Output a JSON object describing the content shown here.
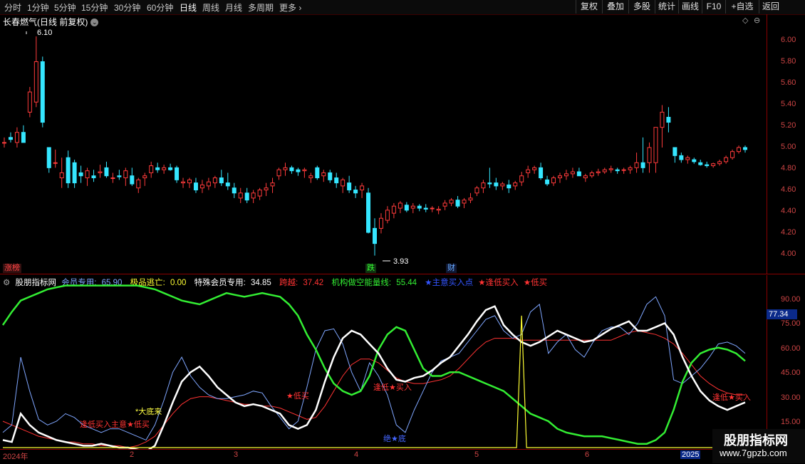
{
  "toolbar": {
    "periods": [
      "分时",
      "1分钟",
      "5分钟",
      "15分钟",
      "30分钟",
      "60分钟",
      "日线",
      "周线",
      "月线",
      "多周期",
      "更多"
    ],
    "active_period": "日线",
    "right_buttons": [
      "复权",
      "叠加",
      "多股",
      "统计",
      "画线",
      "F10",
      "+自选",
      "返回"
    ]
  },
  "stock": {
    "title": "长春燃气(日线 前复权)"
  },
  "price_panel": {
    "ticks": [
      "6.00",
      "5.80",
      "5.60",
      "5.40",
      "5.20",
      "5.00",
      "4.80",
      "4.60",
      "4.40",
      "4.20",
      "4.00"
    ],
    "high_label": "6.10",
    "low_label": "3.93",
    "markers": [
      {
        "text": "涨榜",
        "color": "#ff4444"
      },
      {
        "text": "跌",
        "color": "#33ff33"
      },
      {
        "text": "财",
        "color": "#66aaff"
      }
    ]
  },
  "indicator": {
    "name": "股朋指标网",
    "items": [
      {
        "label": "会员专用:",
        "value": "65.90",
        "color": "#7fa6ff"
      },
      {
        "label": "极品逃亡:",
        "value": "0.00",
        "color": "#ffff33"
      },
      {
        "label": "特殊会员专用:",
        "value": "34.85",
        "color": "#ffffff"
      },
      {
        "label": "跨越:",
        "value": "37.42",
        "color": "#ff3333"
      },
      {
        "label": "机构做空能量线:",
        "value": "55.44",
        "color": "#33ee33"
      }
    ],
    "signals": [
      {
        "text": "★主意买入点",
        "color": "#3355ff"
      },
      {
        "text": "★逢低买入",
        "color": "#ff3333"
      },
      {
        "text": "★低买",
        "color": "#ff3333"
      }
    ],
    "ticks": [
      "90.00",
      "75.00",
      "60.00",
      "45.00",
      "30.00",
      "15.00"
    ],
    "current_value": "77.34",
    "chart_labels": [
      {
        "text": "*大底来",
        "color": "#ffff44"
      },
      {
        "text": "逢低买入主意★低买",
        "color": "#ff3333"
      },
      {
        "text": "★低买",
        "color": "#ff3333"
      },
      {
        "text": "逢低★买入",
        "color": "#ff3333"
      },
      {
        "text": "绝★底",
        "color": "#4466ff"
      },
      {
        "text": "逢低★买入",
        "color": "#ff3333"
      }
    ]
  },
  "dates": [
    "2024年",
    "2",
    "3",
    "4",
    "5",
    "6",
    "2025"
  ],
  "watermark": {
    "title": "股朋指标网",
    "url": "www.7gpzb.com"
  },
  "chart_data": {
    "type": "candlestick",
    "ylim": [
      3.85,
      6.15
    ],
    "candles": [
      [
        5.05,
        5.1,
        5.0,
        5.05
      ],
      [
        5.1,
        5.15,
        5.05,
        5.08
      ],
      [
        5.05,
        5.2,
        5.0,
        5.15
      ],
      [
        5.15,
        5.22,
        5.05,
        5.05
      ],
      [
        5.35,
        5.6,
        5.3,
        5.55
      ],
      [
        5.45,
        6.1,
        5.4,
        5.85
      ],
      [
        5.85,
        5.9,
        5.2,
        5.25
      ],
      [
        5.0,
        5.0,
        4.75,
        4.8
      ],
      [
        4.85,
        4.98,
        4.8,
        4.85
      ],
      [
        4.7,
        4.9,
        4.6,
        4.75
      ],
      [
        4.9,
        4.97,
        4.6,
        4.65
      ],
      [
        4.85,
        4.88,
        4.6,
        4.65
      ],
      [
        4.75,
        4.82,
        4.65,
        4.72
      ],
      [
        4.7,
        4.8,
        4.62,
        4.77
      ],
      [
        4.72,
        4.78,
        4.66,
        4.7
      ],
      [
        4.75,
        4.83,
        4.7,
        4.76
      ],
      [
        4.8,
        4.86,
        4.7,
        4.72
      ],
      [
        4.7,
        4.75,
        4.65,
        4.7
      ],
      [
        4.72,
        4.78,
        4.68,
        4.71
      ],
      [
        4.7,
        4.8,
        4.62,
        4.77
      ],
      [
        4.72,
        4.8,
        4.62,
        4.64
      ],
      [
        4.6,
        4.7,
        4.55,
        4.68
      ],
      [
        4.7,
        4.75,
        4.62,
        4.72
      ],
      [
        4.75,
        4.86,
        4.7,
        4.82
      ],
      [
        4.8,
        4.85,
        4.75,
        4.78
      ],
      [
        4.78,
        4.83,
        4.74,
        4.8
      ],
      [
        4.8,
        4.84,
        4.77,
        4.78
      ],
      [
        4.8,
        4.82,
        4.65,
        4.68
      ],
      [
        4.65,
        4.7,
        4.6,
        4.66
      ],
      [
        4.65,
        4.7,
        4.6,
        4.68
      ],
      [
        4.65,
        4.7,
        4.55,
        4.58
      ],
      [
        4.6,
        4.68,
        4.55,
        4.63
      ],
      [
        4.62,
        4.7,
        4.58,
        4.66
      ],
      [
        4.65,
        4.72,
        4.6,
        4.7
      ],
      [
        4.7,
        4.78,
        4.62,
        4.65
      ],
      [
        4.65,
        4.75,
        4.58,
        4.62
      ],
      [
        4.6,
        4.65,
        4.5,
        4.55
      ],
      [
        4.5,
        4.6,
        4.45,
        4.55
      ],
      [
        4.55,
        4.6,
        4.45,
        4.48
      ],
      [
        4.5,
        4.58,
        4.45,
        4.55
      ],
      [
        4.52,
        4.6,
        4.48,
        4.58
      ],
      [
        4.58,
        4.65,
        4.52,
        4.6
      ],
      [
        4.62,
        4.7,
        4.55,
        4.65
      ],
      [
        4.72,
        4.8,
        4.68,
        4.78
      ],
      [
        4.78,
        4.85,
        4.72,
        4.8
      ],
      [
        4.8,
        4.82,
        4.74,
        4.77
      ],
      [
        4.78,
        4.8,
        4.72,
        4.76
      ],
      [
        4.77,
        4.8,
        4.7,
        4.78
      ],
      [
        4.7,
        4.75,
        4.65,
        4.72
      ],
      [
        4.8,
        4.82,
        4.68,
        4.7
      ],
      [
        4.72,
        4.78,
        4.66,
        4.75
      ],
      [
        4.75,
        4.78,
        4.65,
        4.68
      ],
      [
        4.7,
        4.75,
        4.6,
        4.65
      ],
      [
        4.62,
        4.7,
        4.55,
        4.68
      ],
      [
        4.65,
        4.72,
        4.55,
        4.58
      ],
      [
        4.58,
        4.62,
        4.5,
        4.55
      ],
      [
        4.58,
        4.65,
        4.5,
        4.62
      ],
      [
        4.55,
        4.6,
        4.15,
        4.16
      ],
      [
        4.2,
        4.3,
        3.93,
        4.05
      ],
      [
        4.2,
        4.35,
        4.15,
        4.3
      ],
      [
        4.28,
        4.42,
        4.25,
        4.38
      ],
      [
        4.35,
        4.45,
        4.3,
        4.42
      ],
      [
        4.4,
        4.47,
        4.35,
        4.45
      ],
      [
        4.43,
        4.46,
        4.36,
        4.38
      ],
      [
        4.4,
        4.45,
        4.35,
        4.42
      ],
      [
        4.42,
        4.44,
        4.37,
        4.4
      ],
      [
        4.4,
        4.44,
        4.36,
        4.39
      ],
      [
        4.4,
        4.42,
        4.36,
        4.4
      ],
      [
        4.38,
        4.42,
        4.34,
        4.39
      ],
      [
        4.42,
        4.48,
        4.38,
        4.45
      ],
      [
        4.45,
        4.5,
        4.42,
        4.48
      ],
      [
        4.48,
        4.52,
        4.4,
        4.42
      ],
      [
        4.45,
        4.5,
        4.4,
        4.48
      ],
      [
        4.48,
        4.55,
        4.45,
        4.5
      ],
      [
        4.55,
        4.62,
        4.52,
        4.6
      ],
      [
        4.6,
        4.68,
        4.55,
        4.65
      ],
      [
        4.65,
        4.8,
        4.6,
        4.64
      ],
      [
        4.65,
        4.7,
        4.58,
        4.62
      ],
      [
        4.62,
        4.66,
        4.58,
        4.64
      ],
      [
        4.63,
        4.68,
        4.55,
        4.6
      ],
      [
        4.62,
        4.67,
        4.58,
        4.65
      ],
      [
        4.66,
        4.76,
        4.62,
        4.72
      ],
      [
        4.75,
        4.82,
        4.7,
        4.78
      ],
      [
        4.78,
        4.82,
        4.74,
        4.8
      ],
      [
        4.8,
        4.85,
        4.68,
        4.7
      ],
      [
        4.68,
        4.72,
        4.62,
        4.64
      ],
      [
        4.65,
        4.72,
        4.62,
        4.7
      ],
      [
        4.7,
        4.75,
        4.65,
        4.72
      ],
      [
        4.72,
        4.78,
        4.68,
        4.74
      ],
      [
        4.74,
        4.8,
        4.7,
        4.76
      ],
      [
        4.76,
        4.8,
        4.72,
        4.72
      ],
      [
        4.7,
        4.74,
        4.66,
        4.72
      ],
      [
        4.72,
        4.77,
        4.7,
        4.75
      ],
      [
        4.75,
        4.79,
        4.72,
        4.76
      ],
      [
        4.76,
        4.8,
        4.74,
        4.78
      ],
      [
        4.78,
        4.82,
        4.75,
        4.79
      ],
      [
        4.78,
        4.8,
        4.74,
        4.77
      ],
      [
        4.78,
        4.8,
        4.74,
        4.78
      ],
      [
        4.78,
        4.82,
        4.74,
        4.8
      ],
      [
        4.8,
        4.95,
        4.75,
        4.85
      ],
      [
        4.85,
        5.1,
        4.75,
        4.8
      ],
      [
        4.85,
        5.05,
        4.75,
        5.0
      ],
      [
        4.85,
        5.15,
        4.75,
        5.2
      ],
      [
        5.2,
        5.42,
        5.0,
        5.35
      ],
      [
        5.3,
        5.4,
        5.15,
        5.25
      ],
      [
        5.0,
        5.0,
        4.85,
        4.92
      ],
      [
        4.92,
        4.95,
        4.85,
        4.88
      ],
      [
        4.88,
        4.92,
        4.84,
        4.9
      ],
      [
        4.88,
        4.9,
        4.84,
        4.86
      ],
      [
        4.85,
        4.88,
        4.82,
        4.83
      ],
      [
        4.83,
        4.86,
        4.8,
        4.82
      ],
      [
        4.82,
        4.85,
        4.8,
        4.84
      ],
      [
        4.84,
        4.88,
        4.82,
        4.86
      ],
      [
        4.86,
        4.92,
        4.84,
        4.9
      ],
      [
        4.9,
        4.98,
        4.88,
        4.96
      ],
      [
        4.96,
        5.02,
        4.94,
        5.0
      ],
      [
        5.0,
        5.02,
        4.95,
        4.98
      ]
    ]
  },
  "indicator_series": {
    "ylim": [
      10,
      100
    ],
    "white": [
      14,
      13,
      28,
      22,
      18,
      16,
      14,
      13,
      12,
      11,
      11,
      12,
      11,
      10,
      10,
      9,
      8,
      11,
      22,
      34,
      45,
      50,
      53,
      48,
      42,
      38,
      34,
      32,
      33,
      32,
      30,
      28,
      22,
      20,
      22,
      30,
      45,
      58,
      68,
      72,
      70,
      65,
      60,
      52,
      46,
      45,
      47,
      48,
      51,
      55,
      58,
      64,
      70,
      77,
      83,
      85,
      75,
      70,
      66,
      64,
      66,
      69,
      72,
      70,
      68,
      66,
      67,
      70,
      73,
      75,
      77,
      72,
      72,
      74,
      76,
      70,
      58,
      48,
      40,
      35,
      32,
      30,
      32,
      34
    ],
    "blue": [
      18,
      22,
      58,
      40,
      25,
      22,
      24,
      28,
      26,
      22,
      20,
      18,
      20,
      20,
      18,
      16,
      14,
      22,
      35,
      50,
      58,
      48,
      42,
      38,
      36,
      36,
      37,
      38,
      40,
      39,
      32,
      26,
      20,
      24,
      42,
      62,
      72,
      73,
      65,
      50,
      40,
      55,
      48,
      38,
      22,
      18,
      30,
      40,
      50,
      56,
      58,
      60,
      66,
      72,
      78,
      80,
      72,
      68,
      70,
      82,
      86,
      60,
      66,
      70,
      62,
      58,
      66,
      72,
      74,
      74,
      70,
      76,
      86,
      90,
      80,
      46,
      44,
      48,
      52,
      58,
      65,
      66,
      64,
      60
    ],
    "red": [
      24,
      22,
      20,
      18,
      16,
      15,
      14,
      13,
      13,
      12,
      12,
      11,
      11,
      11,
      10,
      11,
      13,
      16,
      22,
      28,
      33,
      36,
      37,
      37,
      36,
      35,
      34,
      33,
      33,
      32,
      32,
      31,
      29,
      27,
      25,
      26,
      32,
      40,
      48,
      54,
      57,
      57,
      55,
      51,
      47,
      45,
      44,
      44,
      45,
      46,
      48,
      52,
      57,
      62,
      66,
      68,
      68,
      68,
      67,
      67,
      67,
      67,
      67,
      67,
      67,
      67,
      67,
      67,
      67,
      69,
      71,
      72,
      71,
      70,
      68,
      65,
      60,
      54,
      48,
      44,
      41,
      39,
      38,
      38
    ],
    "green": [
      75,
      82,
      88,
      90,
      92,
      94,
      95,
      96,
      96,
      96,
      96,
      96,
      96,
      96,
      96,
      96,
      95,
      94,
      92,
      90,
      88,
      87,
      86,
      88,
      90,
      92,
      91,
      90,
      91,
      92,
      91,
      90,
      86,
      80,
      70,
      62,
      52,
      44,
      40,
      38,
      40,
      48,
      62,
      70,
      74,
      72,
      62,
      52,
      48,
      48,
      50,
      50,
      48,
      46,
      44,
      42,
      40,
      36,
      32,
      28,
      26,
      24,
      20,
      18,
      17,
      16,
      16,
      16,
      15,
      14,
      13,
      12,
      12,
      14,
      18,
      30,
      45,
      55,
      60,
      62,
      63,
      62,
      60,
      56
    ],
    "yellow_spike_index": 58
  }
}
